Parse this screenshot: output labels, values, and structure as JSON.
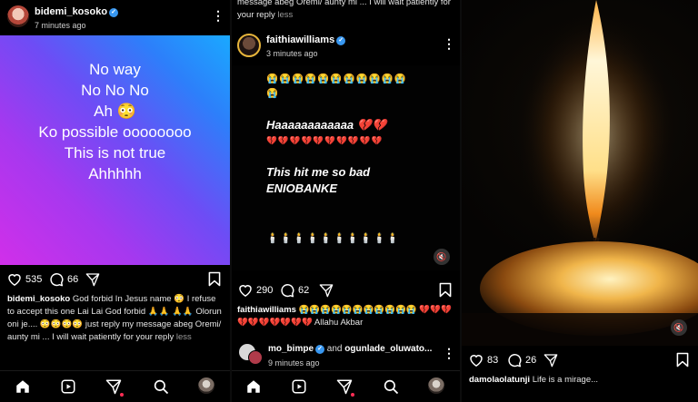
{
  "post1": {
    "username": "bidemi_kosoko",
    "time": "7 minutes ago",
    "image_lines": [
      "No way",
      "No No No",
      "Ah 😳",
      "Ko possible oooooooo",
      "This is not true",
      "Ahhhhh"
    ],
    "likes": "535",
    "comments": "66",
    "caption_user": "bidemi_kosoko",
    "caption_text": "God forbid In Jesus name 😳 I refuse to accept this one Lai Lai God forbid 🙏🙏 🙏🙏 Olorun oni je.... 😳😳😳😳 just reply my message abeg Oremi/ aunty mi ... I will wait patiently for your reply",
    "caption_less": "less"
  },
  "post2": {
    "top_caption_partial": "message abeg Oremi/ aunty mi ... I will wait patiently for your reply",
    "top_caption_less": "less",
    "username": "faithiawilliams",
    "time": "3 minutes ago",
    "emoji_row_1": "😭😭😭😭😭😭😭😭😭😭😭",
    "emoji_row_2": "😭",
    "line_1": "Haaaaaaaaaaaa 💔💔",
    "broken_hearts": "💔💔💔💔💔💔💔💔💔💔",
    "line_2": "This hit me so bad",
    "line_3": "ENIOBANKE",
    "candles": "🕯️🕯️🕯️🕯️🕯️🕯️🕯️🕯️🕯️🕯️",
    "likes": "290",
    "comments": "62",
    "caption_user": "faithiawilliams",
    "caption_text": "😭😭😭😭😭😭😭😭😭😭😭 💔💔💔💔💔💔💔💔💔💔 Allahu Akbar",
    "next_user_1": "mo_bimpe",
    "next_and": "and",
    "next_user_2": "ogunlade_oluwato...",
    "next_time": "9 minutes ago"
  },
  "post3": {
    "likes": "83",
    "comments": "26",
    "caption_user": "damolaolatunji",
    "caption_text": "Life is a mirage..."
  },
  "colors": {
    "accent_red": "#ff2d55",
    "verified_blue": "#3897f0"
  },
  "icons": [
    "heart-icon",
    "comment-icon",
    "share-icon",
    "bookmark-icon",
    "home-icon",
    "reels-icon",
    "send-icon",
    "search-icon",
    "mute-icon",
    "more-icon"
  ]
}
